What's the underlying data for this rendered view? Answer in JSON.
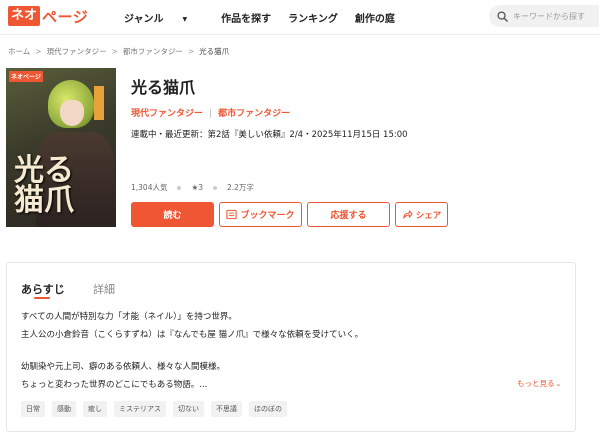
{
  "header": {
    "logo_box": "ネオ",
    "logo_text": "ページ",
    "nav": [
      "ジャンル",
      "作品を探す",
      "ランキング",
      "創作の庭"
    ],
    "search_placeholder": "キーワードから探す"
  },
  "breadcrumb": [
    "ホーム",
    "現代ファンタジー",
    "都市ファンタジー",
    "光る猫爪"
  ],
  "cover": {
    "logo": "ネオページ",
    "title_text": "光る猫爪"
  },
  "work": {
    "title": "光る猫爪",
    "genre_main": "現代ファンタジー",
    "genre_sub": "都市ファンタジー",
    "update_line": "連載中・最近更新：第2話『美しい依頼』2/4・2025年11月15日 15:00",
    "popularity": "1,304人気",
    "rating": "★3",
    "length": "2.2万字"
  },
  "buttons": {
    "read": "読む",
    "bookmark": "ブックマーク",
    "support": "応援する",
    "share": "シェア"
  },
  "synopsis": {
    "tab_synopsis": "あらすじ",
    "tab_detail": "詳細",
    "lines": [
      "すべての人間が特別な力「才能（ネイル）」を持つ世界。",
      "主人公の小倉鈴音（こくらすずね）は『なんでも屋 猫ノ爪』で様々な依頼を受けていく。",
      "幼馴染や元上司、癖のある依頼人、様々な人間模様。",
      "ちょっと変わった世界のどこにでもある物語。..."
    ],
    "more_label": "もっと見る",
    "tags": [
      "日常",
      "感動",
      "癒し",
      "ミステリアス",
      "切ない",
      "不思議",
      "ほのぼの"
    ]
  },
  "colors": {
    "accent": "#ee5634"
  }
}
